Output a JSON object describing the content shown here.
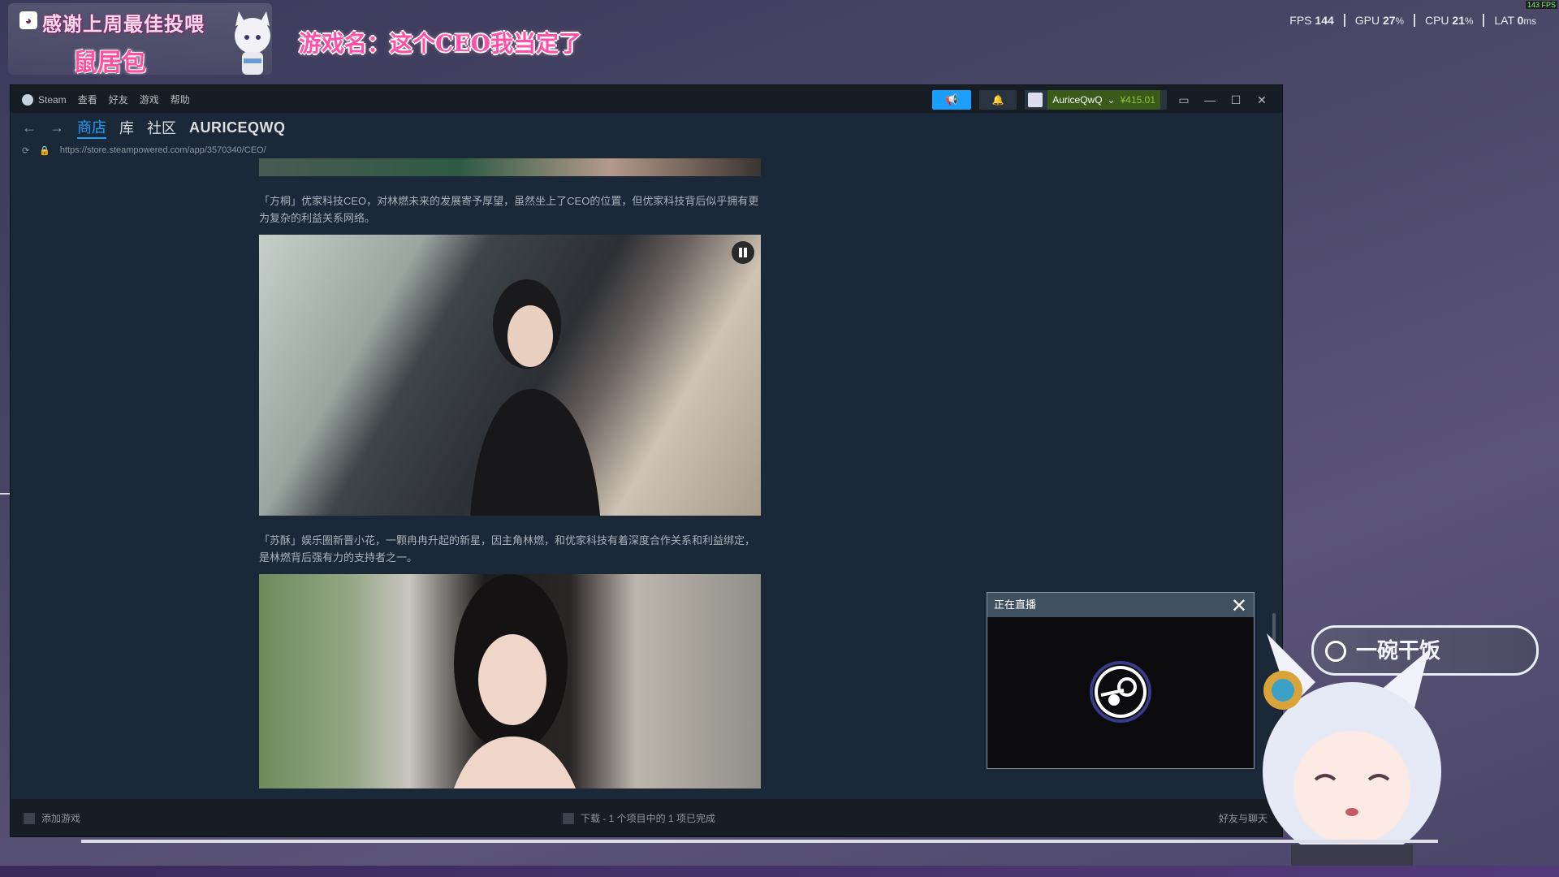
{
  "overlay": {
    "thanks_text": "感谢上周最佳投喂",
    "donor_name": "鼠居包",
    "game_title": "游戏名：这个CEO我当定了",
    "perf": [
      {
        "label": "FPS",
        "value": "144",
        "unit": ""
      },
      {
        "label": "GPU",
        "value": "27",
        "unit": "%"
      },
      {
        "label": "CPU",
        "value": "21",
        "unit": "%"
      },
      {
        "label": "LAT",
        "value": "0",
        "unit": "ms"
      }
    ],
    "fps_small": "143 FPS",
    "search_text": "一碗干饭"
  },
  "steam": {
    "menu": [
      "Steam",
      "查看",
      "好友",
      "游戏",
      "帮助"
    ],
    "account_name": "AuriceQwQ",
    "balance": "¥415.01",
    "tabs": {
      "store": "商店",
      "library": "库",
      "community": "社区",
      "user": "AURICEQWQ"
    },
    "url": "https://store.steampowered.com/app/3570340/CEO/",
    "paragraphs": [
      "「方桐」优家科技CEO，对林燃未来的发展寄予厚望，虽然坐上了CEO的位置，但优家科技背后似乎拥有更为复杂的利益关系网络。",
      "「苏酥」娱乐圈新晋小花，一颗冉冉升起的新星，因主角林燃，和优家科技有着深度合作关系和利益绑定，是林燃背后强有力的支持者之一。"
    ],
    "status": {
      "add_game": "添加游戏",
      "downloads": "下载 - 1 个项目中的 1 项已完成",
      "friends": "好友与聊天"
    },
    "live_panel_title": "正在直播"
  },
  "progress": 0.98,
  "colors": {
    "accent": "#1a9fff",
    "balance": "#8bc53f",
    "pink": "#ff4fa8"
  }
}
